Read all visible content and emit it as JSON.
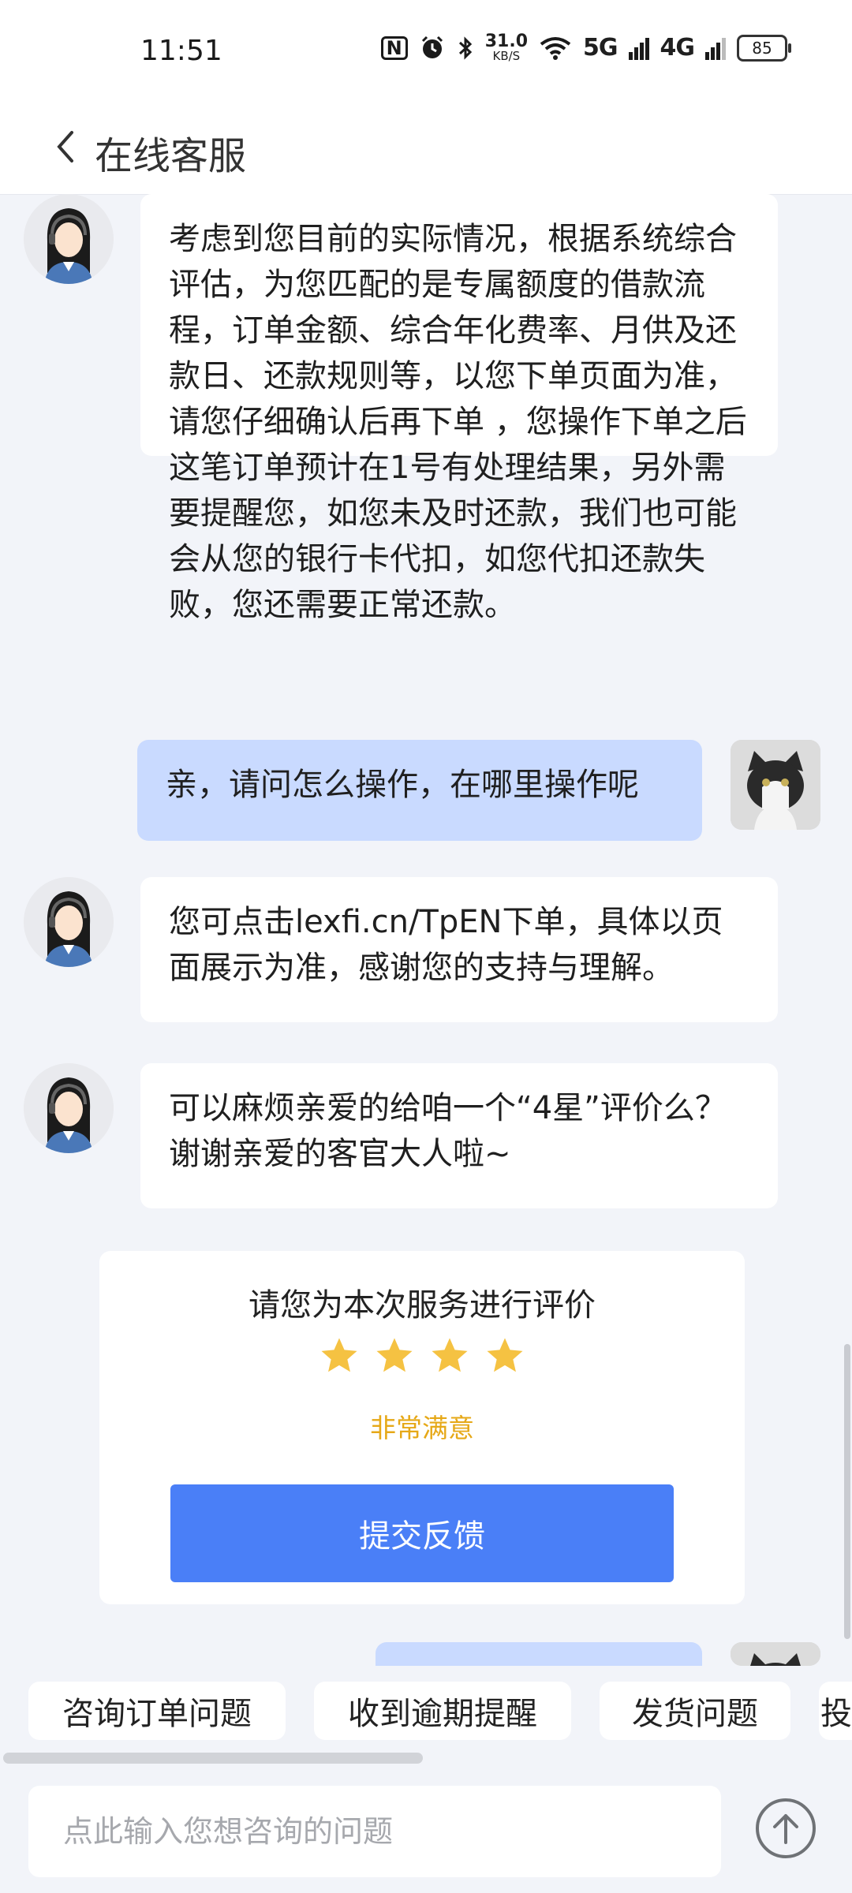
{
  "status_bar": {
    "time": "11:51",
    "nfc": "N",
    "net_speed_value": "31.0",
    "net_speed_unit": "KB/S",
    "signal_1": "5G",
    "signal_2": "4G",
    "battery": "85"
  },
  "header": {
    "title": "在线客服"
  },
  "messages": [
    {
      "from": "agent",
      "text": "考虑到您目前的实际情况，根据系统综合评估，为您匹配的是专属额度的借款流程，订单金额、综合年化费率、月供及还款日、还款规则等，以您下单页面为准，请您仔细确认后再下单 ，您操作下单之后这笔订单预计在1号有处理结果，另外需要提醒您，如您未及时还款，我们也可能会从您的银行卡代扣，如您代扣还款失败，您还需要正常还款。"
    },
    {
      "from": "user",
      "text": "亲，请问怎么操作，在哪里操作呢"
    },
    {
      "from": "agent",
      "text": "您可点击lexfi.cn/TpEN下单，具体以页面展示为准，感谢您的支持与理解。"
    },
    {
      "from": "agent",
      "text": "可以麻烦亲爱的给咱一个“4星”评价么？谢谢亲爱的客官大人啦~"
    }
  ],
  "rating_card": {
    "title": "请您为本次服务进行评价",
    "stars_selected": 4,
    "level_label": "非常满意",
    "submit_label": "提交反馈",
    "star_color": "#F5C242",
    "level_color": "#E6A817"
  },
  "quick_replies": [
    "咨询订单问题",
    "收到逾期提醒",
    "发货问题",
    "投"
  ],
  "input": {
    "placeholder": "点此输入您想咨询的问题",
    "value": ""
  },
  "colors": {
    "accent_blue": "#4A7FF7",
    "user_bubble": "#C9DAFF",
    "background": "#F2F4F9"
  },
  "icons": {
    "back": "chevron-left-icon",
    "send": "arrow-up-circle-icon",
    "agent_avatar": "customer-service-avatar",
    "user_avatar": "cat-avatar"
  }
}
